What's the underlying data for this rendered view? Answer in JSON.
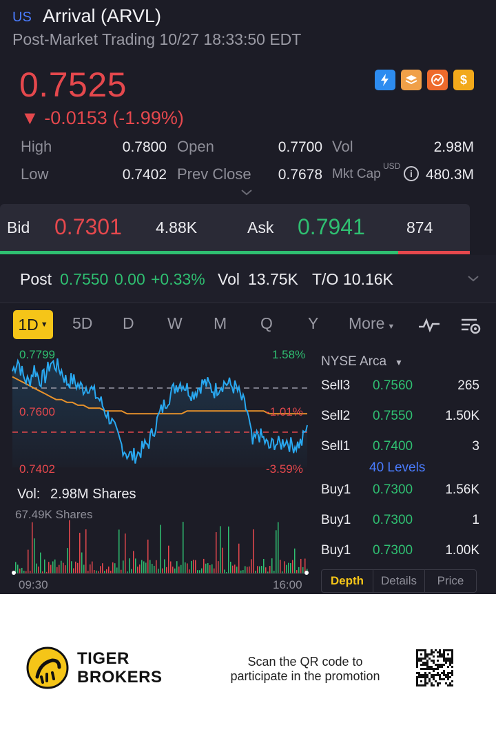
{
  "header": {
    "market_badge": "US",
    "title": "Arrival (ARVL)",
    "subtitle": "Post-Market Trading 10/27 18:33:50 EDT"
  },
  "quote": {
    "price": "0.7525",
    "change": "▼ -0.0153 (-1.99%)",
    "status_icons": [
      "lightning-icon",
      "stack-icon",
      "chart-circle-icon",
      "dollar-icon"
    ]
  },
  "stats": {
    "high_label": "High",
    "high": "0.7800",
    "low_label": "Low",
    "low": "0.7402",
    "open_label": "Open",
    "open": "0.7700",
    "prev_close_label": "Prev Close",
    "prev_close": "0.7678",
    "vol_label": "Vol",
    "vol": "2.98M",
    "mkt_cap_label": "Mkt Cap",
    "mkt_cap_currency": "USD",
    "mkt_cap": "480.3M"
  },
  "bid_ask": {
    "bid_label": "Bid",
    "bid": "0.7301",
    "bid_size": "4.88K",
    "ask_label": "Ask",
    "ask": "0.7941",
    "ask_size": "874",
    "bid_share": 0.848
  },
  "post": {
    "label": "Post",
    "price": "0.7550",
    "change": "0.00",
    "pct": "+0.33%",
    "vol_label": "Vol",
    "vol": "13.75K",
    "to_label": "T/O",
    "to": "10.16K"
  },
  "tabs": {
    "active": "1D",
    "items": [
      "5D",
      "D",
      "W",
      "M",
      "Q",
      "Y"
    ],
    "more": "More"
  },
  "chart": {
    "price_high": "0.7799",
    "price_mid": "0.7600",
    "price_low": "0.7402",
    "pct_high": "1.58%",
    "pct_mid": "-1.01%",
    "pct_low": "-3.59%",
    "vol_label": "Vol:",
    "vol_value": "2.98M Shares",
    "vol_axis": "67.49K Shares",
    "time_start": "09:30",
    "time_end": "16:00"
  },
  "chart_data": {
    "type": "line",
    "series": [
      {
        "values": [
          0.774,
          0.778,
          0.772,
          0.77,
          0.775,
          0.771,
          0.772,
          0.777,
          0.776,
          0.774,
          0.77,
          0.771,
          0.769,
          0.768,
          0.769,
          0.766,
          0.764,
          0.76,
          0.757,
          0.752,
          0.748,
          0.745,
          0.744,
          0.745,
          0.747,
          0.749,
          0.754,
          0.759,
          0.763,
          0.766,
          0.769,
          0.77,
          0.768,
          0.766,
          0.768,
          0.77,
          0.769,
          0.767,
          0.769,
          0.77,
          0.769,
          0.768,
          0.764,
          0.76,
          0.748,
          0.752,
          0.75,
          0.747,
          0.749,
          0.748,
          0.75,
          0.748,
          0.748,
          0.749,
          0.755
        ]
      },
      {
        "values": [
          0.772,
          0.771,
          0.77,
          0.769,
          0.768,
          0.767,
          0.766,
          0.765,
          0.764,
          0.764,
          0.763,
          0.763,
          0.762,
          0.762,
          0.761,
          0.761,
          0.761,
          0.76,
          0.76,
          0.76,
          0.76,
          0.759,
          0.759,
          0.759,
          0.759,
          0.759,
          0.759,
          0.759,
          0.759,
          0.759,
          0.759,
          0.759,
          0.76,
          0.76,
          0.76,
          0.76,
          0.76,
          0.76,
          0.76,
          0.76,
          0.76,
          0.76,
          0.76,
          0.76,
          0.76,
          0.76,
          0.76,
          0.759,
          0.759,
          0.759,
          0.759,
          0.759,
          0.759,
          0.759,
          0.759
        ]
      }
    ],
    "ylim": [
      0.7402,
      0.7799
    ],
    "reference_lines": [
      0.7678,
      0.76
    ],
    "x_labels": [
      "09:30",
      "16:00"
    ]
  },
  "orderbook": {
    "exchange": "NYSE Arca",
    "sells": [
      {
        "label": "Sell3",
        "price": "0.7560",
        "size": "265"
      },
      {
        "label": "Sell2",
        "price": "0.7550",
        "size": "1.50K"
      },
      {
        "label": "Sell1",
        "price": "0.7400",
        "size": "3"
      }
    ],
    "levels": "40 Levels",
    "buys": [
      {
        "label": "Buy1",
        "price": "0.7300",
        "size": "1.56K"
      },
      {
        "label": "Buy1",
        "price": "0.7300",
        "size": "1"
      },
      {
        "label": "Buy1",
        "price": "0.7300",
        "size": "1.00K"
      }
    ],
    "buttons": [
      "Depth",
      "Details",
      "Price"
    ]
  },
  "footer": {
    "brand_line1": "TIGER",
    "brand_line2": "BROKERS",
    "promo": "Scan the QR code to participate in the promotion"
  },
  "colors": {
    "up": "#2fbf71",
    "down": "#e5484d",
    "accent": "#f5c518",
    "price_line": "#29a8f0",
    "avg_line": "#e8922b",
    "background": "#1c1c26"
  }
}
